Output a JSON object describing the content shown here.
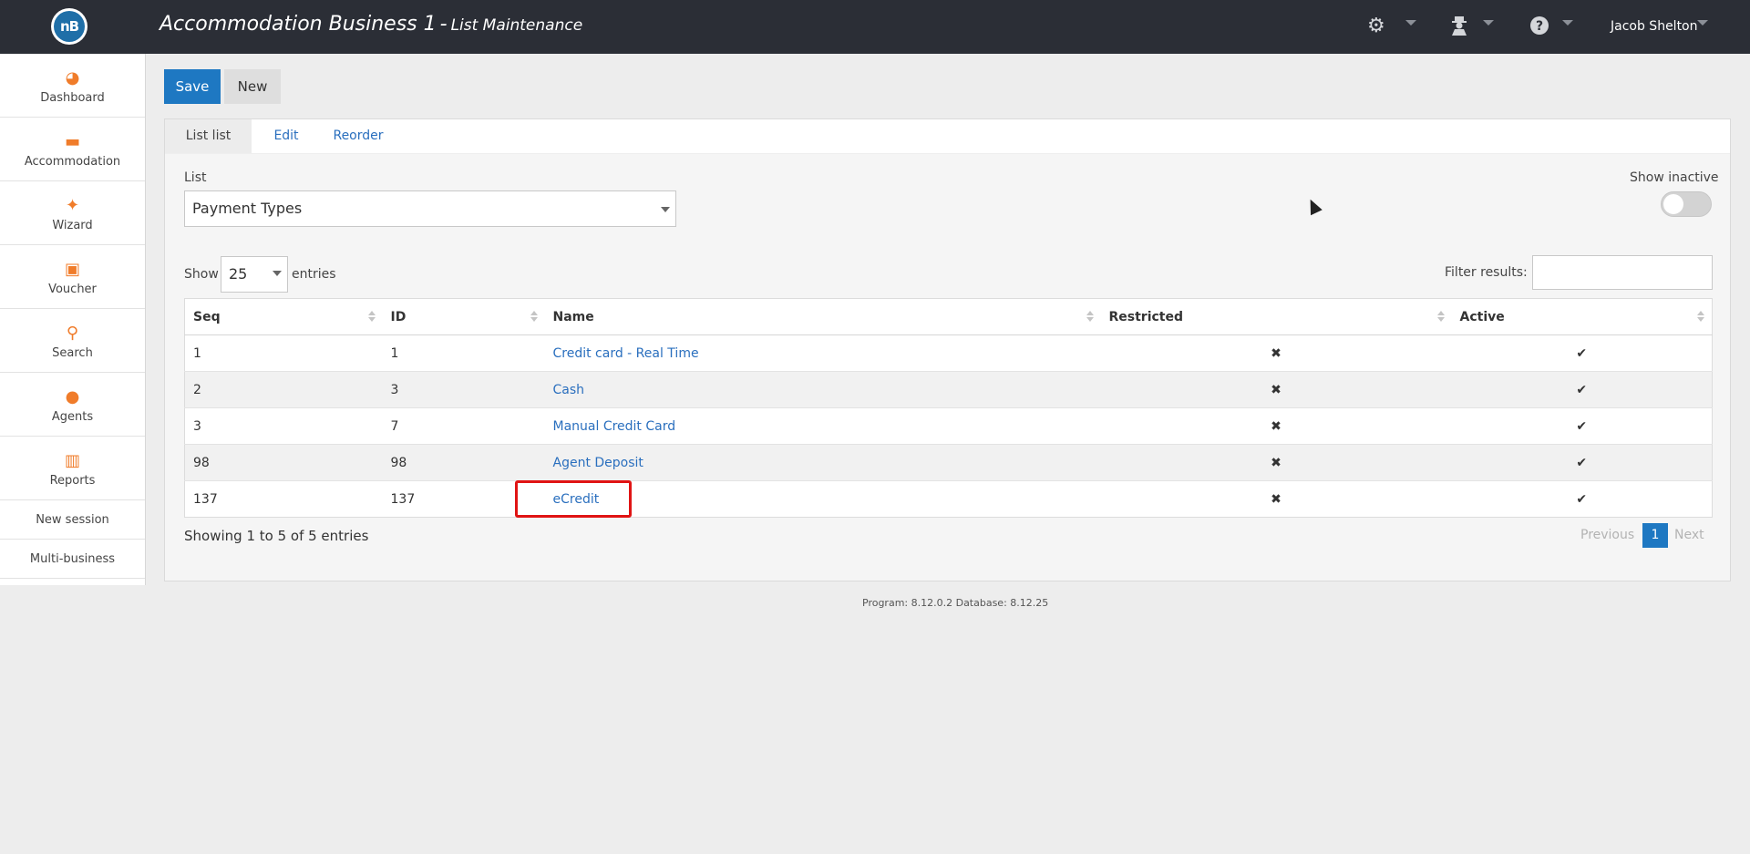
{
  "header": {
    "logo_text": "nB",
    "business_name": "Accommodation Business 1",
    "separator": "-",
    "page_name": "List Maintenance",
    "settings_icon": "gears-icon",
    "agent_icon": "user-secret-icon",
    "help_icon": "question-circle-icon",
    "user_name": "Jacob Shelton"
  },
  "sidebar": {
    "items": [
      {
        "label": "Dashboard",
        "icon": "dashboard-icon",
        "glyph": "◕"
      },
      {
        "label": "Accommodation",
        "icon": "bed-icon",
        "glyph": "▬"
      },
      {
        "label": "Wizard",
        "icon": "magic-wand-icon",
        "glyph": "✦"
      },
      {
        "label": "Voucher",
        "icon": "gift-icon",
        "glyph": "▣"
      },
      {
        "label": "Search",
        "icon": "search-icon",
        "glyph": "⚲"
      },
      {
        "label": "Agents",
        "icon": "user-icon",
        "glyph": "●"
      },
      {
        "label": "Reports",
        "icon": "bar-chart-icon",
        "glyph": "▥"
      }
    ],
    "new_session": "New session",
    "multi_business": "Multi-business"
  },
  "toolbar": {
    "save_label": "Save",
    "new_label": "New"
  },
  "tabs": [
    {
      "label": "List list",
      "active": true
    },
    {
      "label": "Edit",
      "active": false
    },
    {
      "label": "Reorder",
      "active": false
    }
  ],
  "form": {
    "list_label": "List",
    "list_value": "Payment Types",
    "show_inactive_label": "Show inactive",
    "show_inactive_on": false
  },
  "table_controls": {
    "show_label": "Show",
    "entries_value": "25",
    "entries_label": "entries",
    "filter_label": "Filter results:",
    "filter_value": ""
  },
  "table": {
    "columns": [
      "Seq",
      "ID",
      "Name",
      "Restricted",
      "Active"
    ],
    "rows": [
      {
        "seq": "1",
        "id": "1",
        "name": "Credit card - Real Time",
        "restricted": "✖",
        "active": "✔"
      },
      {
        "seq": "2",
        "id": "3",
        "name": "Cash",
        "restricted": "✖",
        "active": "✔"
      },
      {
        "seq": "3",
        "id": "7",
        "name": "Manual Credit Card",
        "restricted": "✖",
        "active": "✔"
      },
      {
        "seq": "98",
        "id": "98",
        "name": "Agent Deposit",
        "restricted": "✖",
        "active": "✔"
      },
      {
        "seq": "137",
        "id": "137",
        "name": "eCredit",
        "restricted": "✖",
        "active": "✔"
      }
    ]
  },
  "pagination": {
    "summary": "Showing 1 to 5 of 5 entries",
    "previous": "Previous",
    "current": "1",
    "next": "Next"
  },
  "footer": {
    "version_text": "Program: 8.12.0.2 Database: 8.12.25"
  },
  "colors": {
    "topbar": "#2b2e36",
    "accent_blue": "#1e78c2",
    "sidebar_icon": "#f07c2a",
    "link": "#2a6fbe",
    "highlight": "#e01414",
    "check": "#2e9a2e"
  }
}
